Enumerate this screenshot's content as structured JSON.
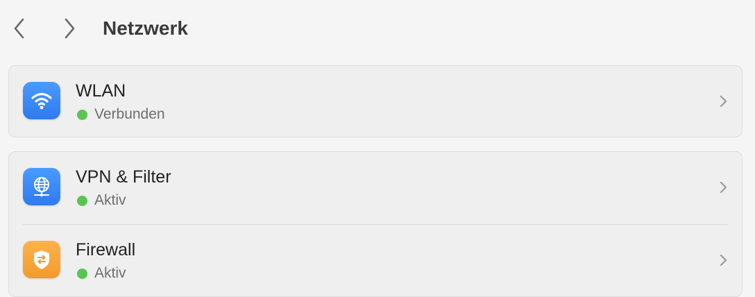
{
  "toolbar": {
    "back_icon": "chevron-left-icon",
    "forward_icon": "chevron-right-icon",
    "title": "Netzwerk"
  },
  "groups": [
    {
      "rows": [
        {
          "title": "WLAN",
          "status": "Verbunden",
          "status_color": "#5ac451",
          "icon": "wifi-icon",
          "icon_color": "#3b8af6"
        }
      ]
    },
    {
      "rows": [
        {
          "title": "VPN & Filter",
          "status": "Aktiv",
          "status_color": "#5ac451",
          "icon": "globe-network-icon",
          "icon_color": "#3b8af6"
        },
        {
          "title": "Firewall",
          "status": "Aktiv",
          "status_color": "#5ac451",
          "icon": "shield-icon",
          "icon_color": "#f5a23a"
        }
      ]
    }
  ]
}
